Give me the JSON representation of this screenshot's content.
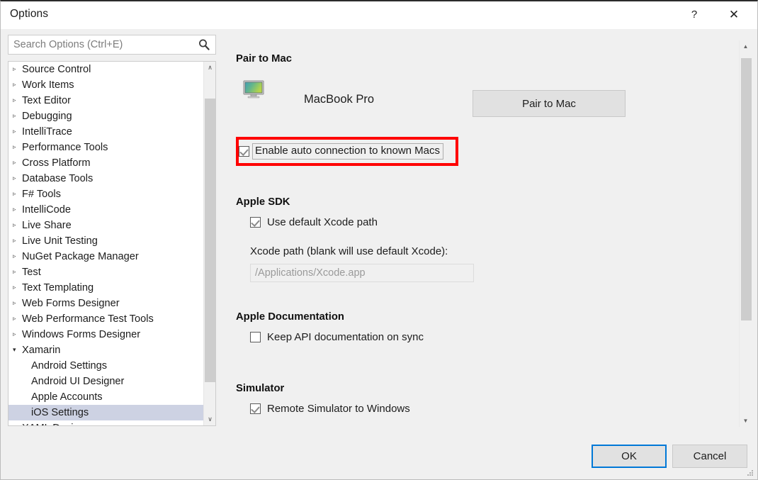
{
  "window": {
    "title": "Options",
    "help_label": "?",
    "close_label": "✕"
  },
  "search": {
    "placeholder": "Search Options (Ctrl+E)",
    "value": "",
    "icon": "search-icon"
  },
  "tree": {
    "items": [
      {
        "label": "Source Control",
        "arrow": "▹",
        "expanded": false,
        "child": false,
        "selected": false
      },
      {
        "label": "Work Items",
        "arrow": "▹",
        "expanded": false,
        "child": false,
        "selected": false
      },
      {
        "label": "Text Editor",
        "arrow": "▹",
        "expanded": false,
        "child": false,
        "selected": false
      },
      {
        "label": "Debugging",
        "arrow": "▹",
        "expanded": false,
        "child": false,
        "selected": false
      },
      {
        "label": "IntelliTrace",
        "arrow": "▹",
        "expanded": false,
        "child": false,
        "selected": false
      },
      {
        "label": "Performance Tools",
        "arrow": "▹",
        "expanded": false,
        "child": false,
        "selected": false
      },
      {
        "label": "Cross Platform",
        "arrow": "▹",
        "expanded": false,
        "child": false,
        "selected": false
      },
      {
        "label": "Database Tools",
        "arrow": "▹",
        "expanded": false,
        "child": false,
        "selected": false
      },
      {
        "label": "F# Tools",
        "arrow": "▹",
        "expanded": false,
        "child": false,
        "selected": false
      },
      {
        "label": "IntelliCode",
        "arrow": "▹",
        "expanded": false,
        "child": false,
        "selected": false
      },
      {
        "label": "Live Share",
        "arrow": "▹",
        "expanded": false,
        "child": false,
        "selected": false
      },
      {
        "label": "Live Unit Testing",
        "arrow": "▹",
        "expanded": false,
        "child": false,
        "selected": false
      },
      {
        "label": "NuGet Package Manager",
        "arrow": "▹",
        "expanded": false,
        "child": false,
        "selected": false
      },
      {
        "label": "Test",
        "arrow": "▹",
        "expanded": false,
        "child": false,
        "selected": false
      },
      {
        "label": "Text Templating",
        "arrow": "▹",
        "expanded": false,
        "child": false,
        "selected": false
      },
      {
        "label": "Web Forms Designer",
        "arrow": "▹",
        "expanded": false,
        "child": false,
        "selected": false
      },
      {
        "label": "Web Performance Test Tools",
        "arrow": "▹",
        "expanded": false,
        "child": false,
        "selected": false
      },
      {
        "label": "Windows Forms Designer",
        "arrow": "▹",
        "expanded": false,
        "child": false,
        "selected": false
      },
      {
        "label": "Xamarin",
        "arrow": "▾",
        "expanded": true,
        "child": false,
        "selected": false
      },
      {
        "label": "Android Settings",
        "arrow": "",
        "expanded": false,
        "child": true,
        "selected": false
      },
      {
        "label": "Android UI Designer",
        "arrow": "",
        "expanded": false,
        "child": true,
        "selected": false
      },
      {
        "label": "Apple Accounts",
        "arrow": "",
        "expanded": false,
        "child": true,
        "selected": false
      },
      {
        "label": "iOS Settings",
        "arrow": "",
        "expanded": false,
        "child": true,
        "selected": true
      },
      {
        "label": "XAML Designer",
        "arrow": "▹",
        "expanded": false,
        "child": false,
        "selected": false
      }
    ],
    "scroll_up_glyph": "∧",
    "scroll_down_glyph": "∨"
  },
  "content": {
    "pair_to_mac": {
      "section_title": "Pair to Mac",
      "mac_name": "MacBook Pro",
      "mac_icon": "monitor-icon",
      "button_label": "Pair to Mac",
      "auto_connect_label": "Enable auto connection to known Macs",
      "auto_connect_checked": true,
      "highlight_color": "#ff0000"
    },
    "apple_sdk": {
      "section_title": "Apple SDK",
      "use_default_xcode_label": "Use default Xcode path",
      "use_default_xcode_checked": true,
      "xcode_path_label": "Xcode path (blank will use default Xcode):",
      "xcode_path_placeholder": "/Applications/Xcode.app",
      "xcode_path_value": ""
    },
    "apple_documentation": {
      "section_title": "Apple Documentation",
      "keep_api_doc_label": "Keep API documentation on sync",
      "keep_api_doc_checked": false
    },
    "simulator": {
      "section_title": "Simulator",
      "remote_simulator_label": "Remote Simulator to Windows",
      "remote_simulator_checked": true
    },
    "scroll_up_glyph": "▲",
    "scroll_down_glyph": "▼"
  },
  "footer": {
    "ok_label": "OK",
    "cancel_label": "Cancel",
    "ok_accent_color": "#0078d7"
  }
}
